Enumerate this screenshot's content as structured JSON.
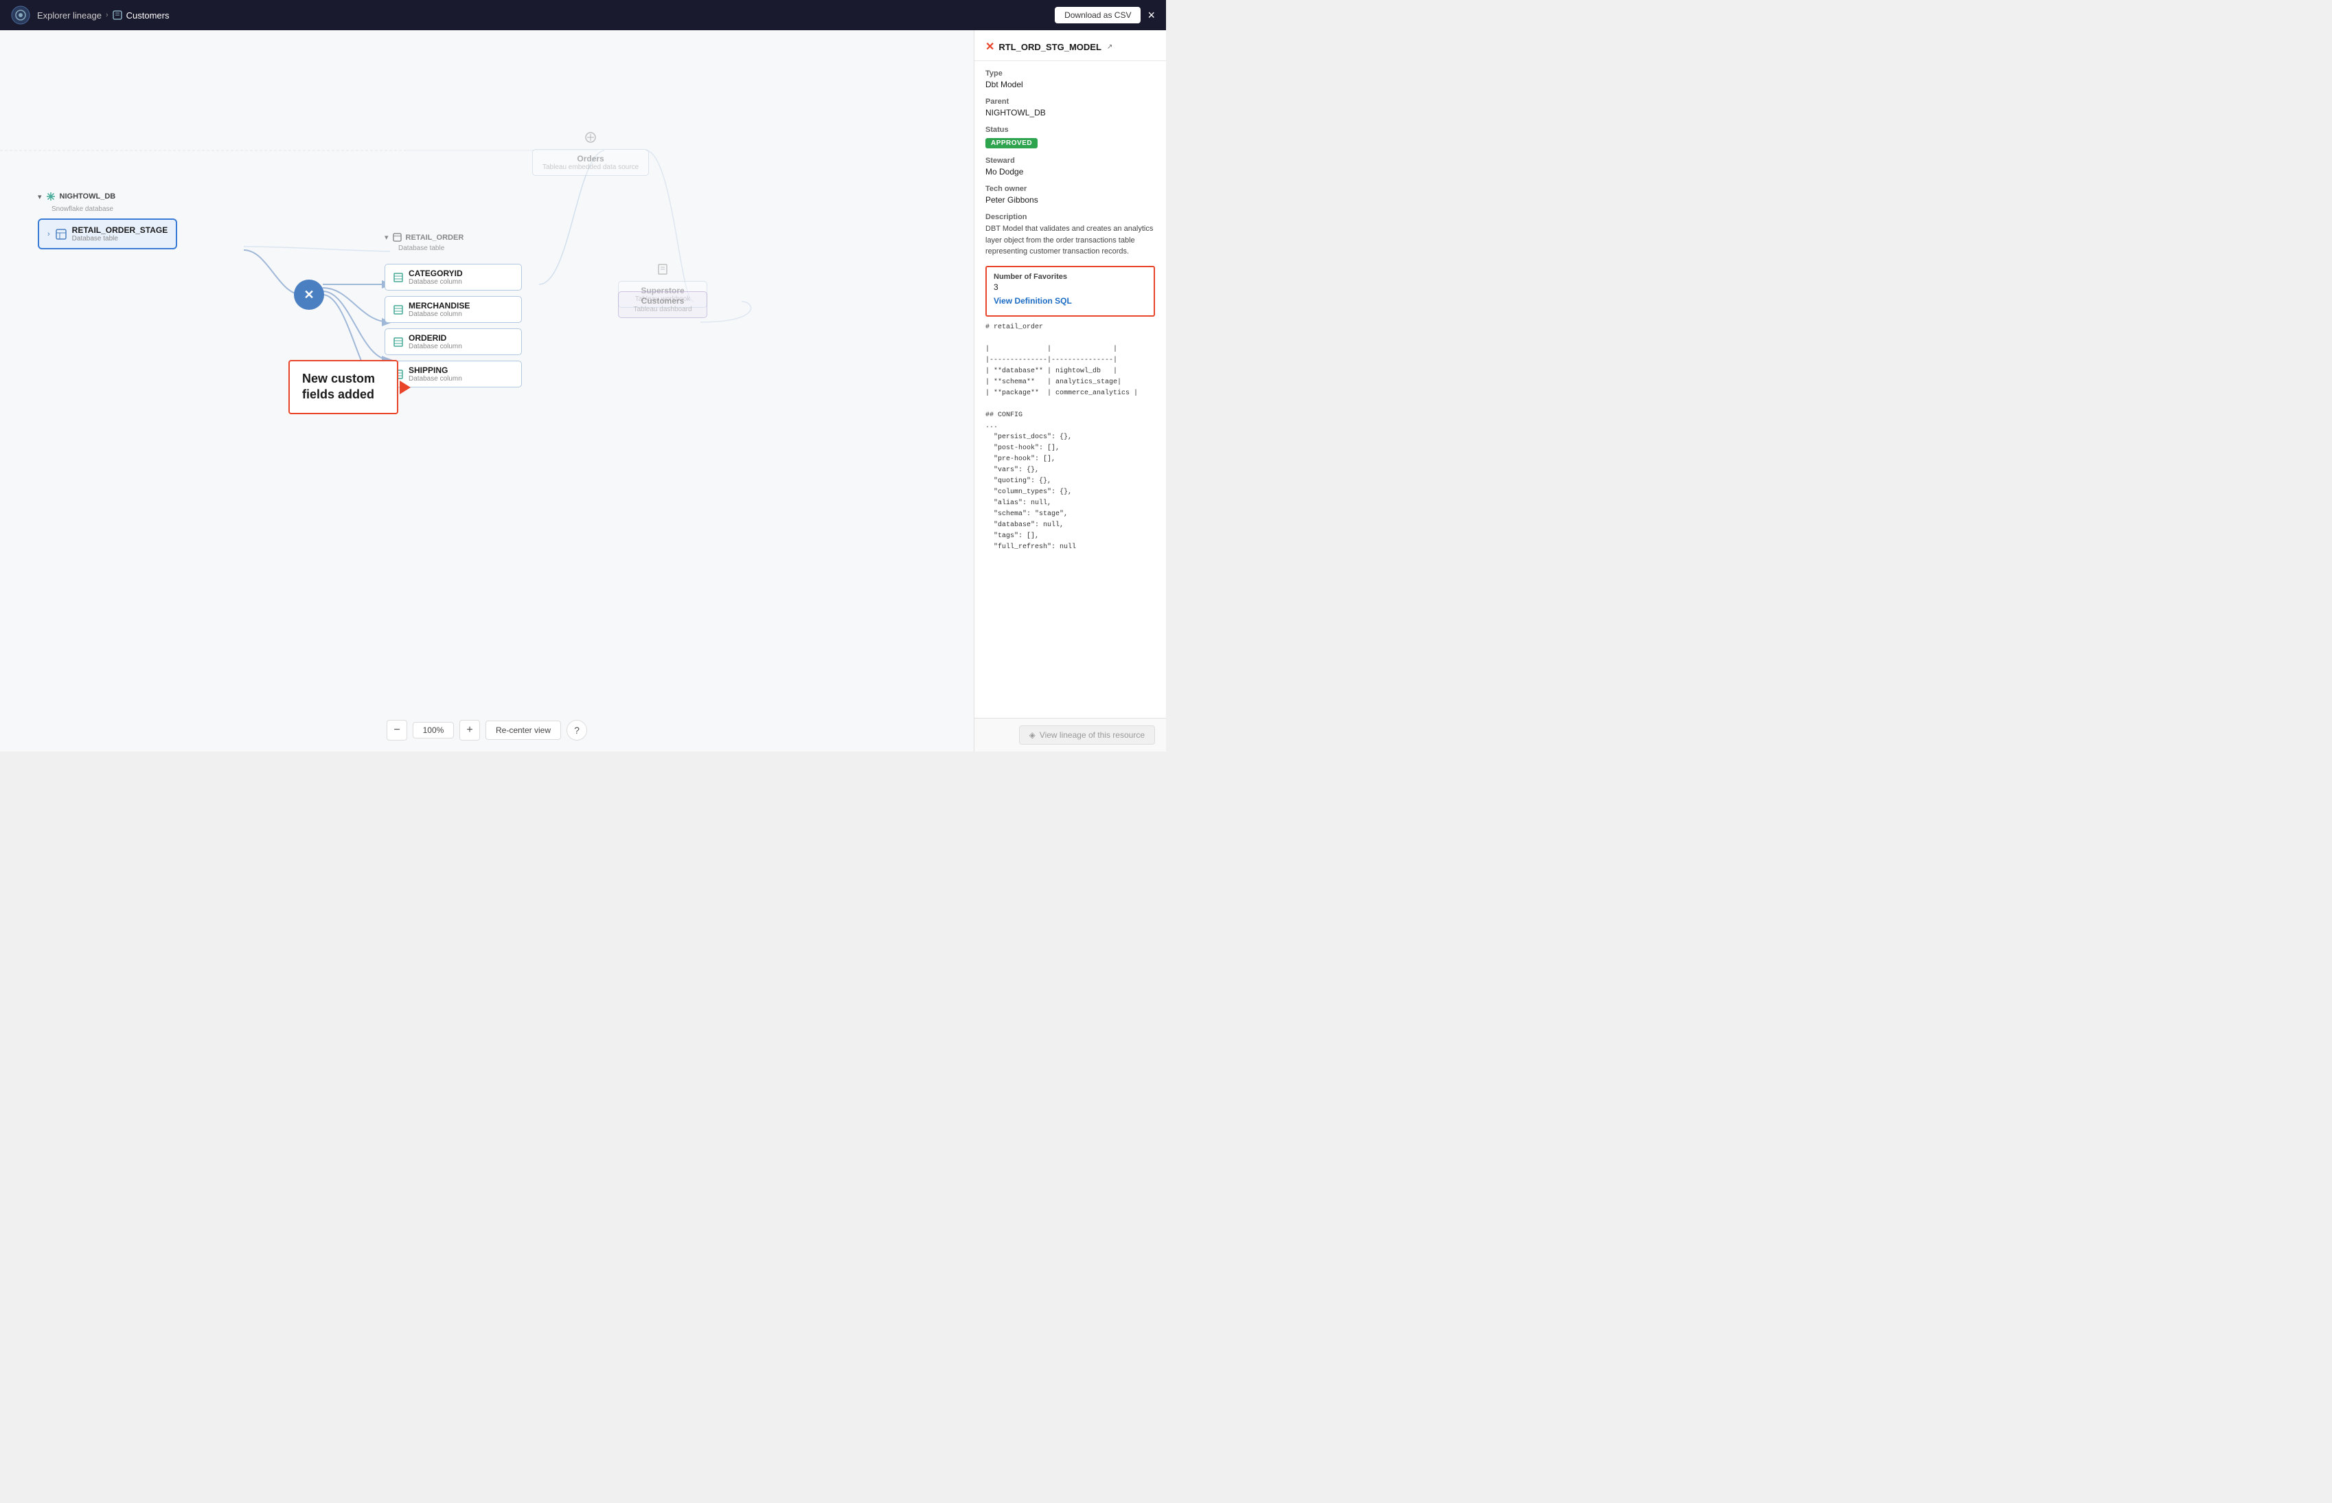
{
  "header": {
    "app_name": "Explorer lineage",
    "breadcrumb_separator": "›",
    "current_page": "Customers",
    "download_btn": "Download as CSV",
    "close_btn": "×"
  },
  "canvas": {
    "zoom_level": "100%",
    "zoom_minus": "−",
    "zoom_plus": "+",
    "recenter_btn": "Re-center view",
    "help_btn": "?"
  },
  "nodes": {
    "nightowl_db": {
      "label": "NIGHTOWL_DB",
      "sublabel": "Snowflake database"
    },
    "retail_order_stage": {
      "title": "RETAIL_ORDER_STAGE",
      "subtitle": "Database table"
    },
    "retail_order_group": {
      "label": "RETAIL_ORDER",
      "sublabel": "Database table"
    },
    "columns": [
      {
        "name": "CATEGORYID",
        "subtitle": "Database column"
      },
      {
        "name": "MERCHANDISE",
        "subtitle": "Database column"
      },
      {
        "name": "ORDERID",
        "subtitle": "Database column"
      },
      {
        "name": "SHIPPING",
        "subtitle": "Database column"
      }
    ],
    "orders": {
      "title": "Orders",
      "subtitle": "Tableau embedded data source"
    },
    "superstore": {
      "title": "Superstore",
      "subtitle": "Tableau workbook"
    },
    "customers": {
      "title": "Customers",
      "subtitle": "Tableau dashboard"
    }
  },
  "callout": {
    "text": "New custom\nfields added"
  },
  "panel": {
    "title": "RTL_ORD_STG_MODEL",
    "type_label": "Type",
    "type_value": "Dbt Model",
    "parent_label": "Parent",
    "parent_value": "NIGHTOWL_DB",
    "status_label": "Status",
    "status_value": "APPROVED",
    "steward_label": "Steward",
    "steward_value": "Mo Dodge",
    "tech_owner_label": "Tech owner",
    "tech_owner_value": "Peter Gibbons",
    "description_label": "Description",
    "description_value": "DBT Model that validates and creates an analytics layer object from the order transactions table representing customer transaction records.",
    "num_favorites_label": "Number of Favorites",
    "num_favorites_value": "3",
    "view_def_label": "View Definition SQL",
    "code_content": "# retail_order\n\n|              |               |\n|--------------|---------------|\n| **database** | nightowl_db   |\n| **schema**   | analytics_stage|\n| **package**  | commerce_analytics |\n\n## CONFIG\n...\n  \"persist_docs\": {},\n  \"post-hook\": [],\n  \"pre-hook\": [],\n  \"vars\": {},\n  \"quoting\": {},\n  \"column_types\": {},\n  \"alias\": null,\n  \"schema\": \"stage\",\n  \"database\": null,\n  \"tags\": [],\n  \"full_refresh\": null",
    "view_lineage_btn": "View lineage of this resource",
    "view_lineage_icon": "◈"
  }
}
